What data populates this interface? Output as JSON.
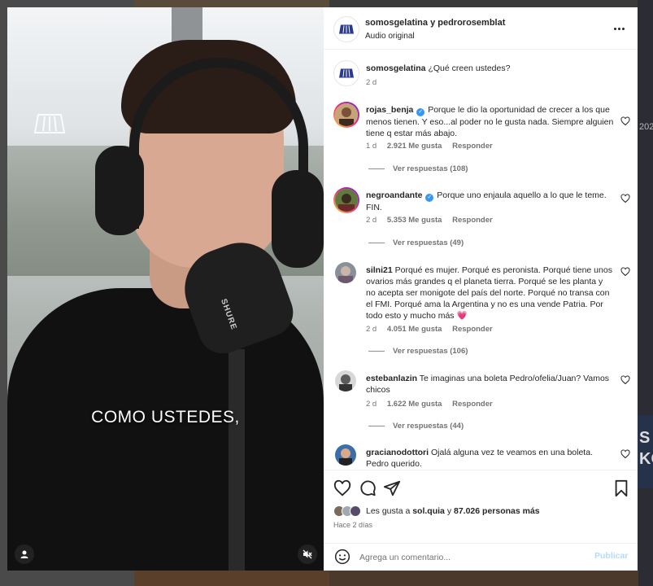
{
  "background": {
    "side_text_1": "202",
    "side_text_2": "S\nKO"
  },
  "video": {
    "caption": "COMO USTEDES,",
    "mic_brand": "SHURE"
  },
  "post_header": {
    "title": "somosgelatina y pedrorosemblat",
    "audio": "Audio original"
  },
  "caption_comment": {
    "username": "somosgelatina",
    "text": "¿Qué creen ustedes?",
    "time": "2 d"
  },
  "comments": [
    {
      "username": "rojas_benja",
      "verified": true,
      "text": "Porque le dio la oportunidad de crecer a los que menos tienen. Y eso...al poder no le gusta nada. Siempre alguien tiene q estar más abajo.",
      "time": "1 d",
      "likes": "2.921 Me gusta",
      "reply": "Responder",
      "replies": "Ver respuestas (108)"
    },
    {
      "username": "negroandante",
      "verified": true,
      "text": "Porque uno enjaula aquello a lo que le teme. FIN.",
      "time": "2 d",
      "likes": "5.353 Me gusta",
      "reply": "Responder",
      "replies": "Ver respuestas (49)"
    },
    {
      "username": "silni21",
      "verified": false,
      "text": "Porqué es mujer. Porqué es peronista. Porqué tiene unos ovarios más grandes q el planeta tierra. Porqué se les planta y no acepta ser monigote del país del norte. Porqué no transa con el FMI. Porqué ama la Argentina y no es una vende Patria. Por todo esto y mucho más 💗",
      "time": "2 d",
      "likes": "4.051 Me gusta",
      "reply": "Responder",
      "replies": "Ver respuestas (106)"
    },
    {
      "username": "estebanlazin",
      "verified": false,
      "text": "Te imaginas una boleta Pedro/ofelia/Juan? Vamos chicos",
      "time": "2 d",
      "likes": "1.622 Me gusta",
      "reply": "Responder",
      "replies": "Ver respuestas (44)"
    },
    {
      "username": "gracianodottori",
      "verified": false,
      "text": "Ojalá alguna vez te veamos en una boleta. Pedro querido."
    }
  ],
  "likes": {
    "prefix": "Les gusta a",
    "user": "sol.quia",
    "middle": "y",
    "count": "87.026 personas más"
  },
  "time_ago": "Hace 2 días",
  "add_comment": {
    "placeholder": "Agrega un comentario...",
    "publish": "Publicar"
  },
  "colors": {
    "link_blue": "#3897f0",
    "publish_disabled": "#b3dbff",
    "heart_pink": "#ee2a7b"
  }
}
